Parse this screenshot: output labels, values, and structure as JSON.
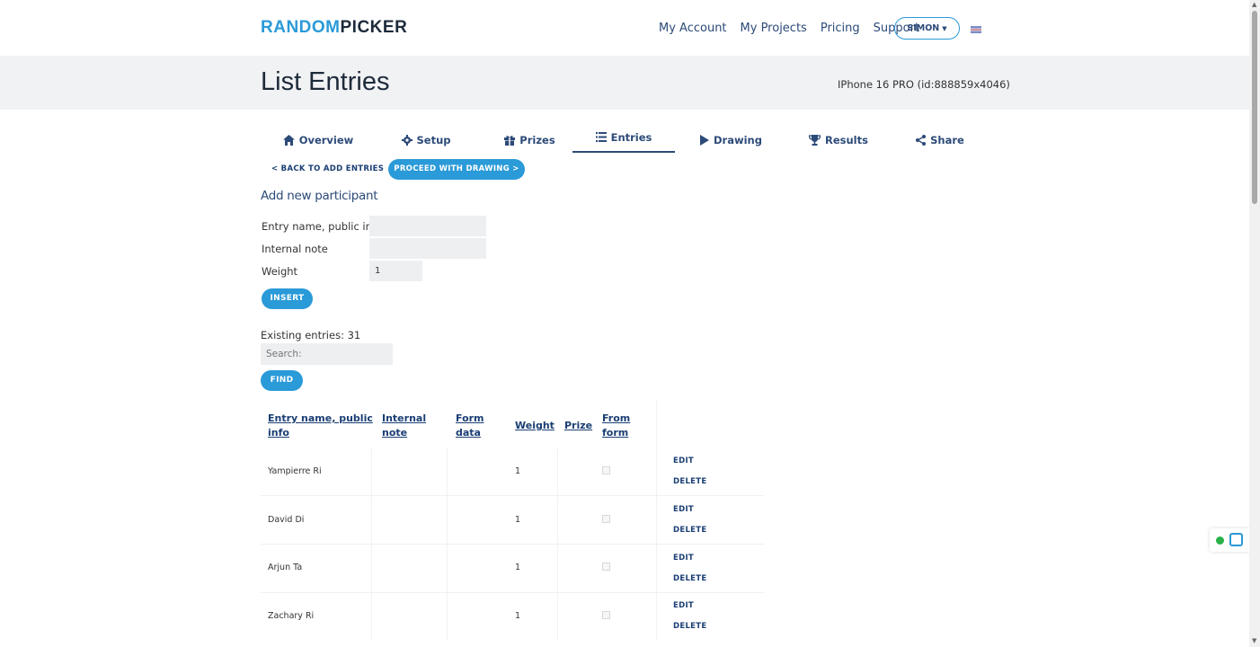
{
  "header": {
    "logo_part1": "RANDOM",
    "logo_part2": "PICKER",
    "nav": [
      "My Account",
      "My Projects",
      "Pricing",
      "Support"
    ],
    "user": "SIMON",
    "lang_flag_icon": "uk-flag-icon"
  },
  "titlebar": {
    "title": "List Entries",
    "project": "IPhone 16 PRO (id:888859x4046)"
  },
  "tabs": [
    {
      "label": "Overview",
      "icon": "home-icon"
    },
    {
      "label": "Setup",
      "icon": "gear-icon"
    },
    {
      "label": "Prizes",
      "icon": "gift-icon"
    },
    {
      "label": "Entries",
      "icon": "list-icon",
      "active": true
    },
    {
      "label": "Drawing",
      "icon": "play-icon"
    },
    {
      "label": "Results",
      "icon": "trophy-icon"
    },
    {
      "label": "Share",
      "icon": "share-icon"
    }
  ],
  "actions": {
    "back": "< BACK TO ADD ENTRIES",
    "proceed": "PROCEED WITH DRAWING >"
  },
  "form": {
    "title": "Add new participant",
    "name_label": "Entry name, public info",
    "name_value": "",
    "note_label": "Internal note",
    "note_value": "",
    "weight_label": "Weight",
    "weight_value": "1",
    "insert": "INSERT"
  },
  "list": {
    "existing": "Existing entries: 31",
    "search_placeholder": "Search:",
    "find": "FIND",
    "columns": {
      "name_line1": "Entry name, public",
      "name_line2": "info",
      "note_line1": "Internal",
      "note_line2": "note",
      "form_line1": "Form",
      "form_line2": "data",
      "weight": "Weight",
      "prize": "Prize",
      "fromform_line1": "From",
      "fromform_line2": "form"
    },
    "rows": [
      {
        "name": "Yampierre Ri",
        "weight": "1",
        "edit": "EDIT",
        "delete": "DELETE"
      },
      {
        "name": "David Di",
        "weight": "1",
        "edit": "EDIT",
        "delete": "DELETE"
      },
      {
        "name": "Arjun Ta",
        "weight": "1",
        "edit": "EDIT",
        "delete": "DELETE"
      },
      {
        "name": "Zachary Ri",
        "weight": "1",
        "edit": "EDIT",
        "delete": "DELETE"
      }
    ]
  },
  "colors": {
    "accent": "#2a9ad8",
    "nav_text": "#2c4a78",
    "band": "#f1f2f4"
  }
}
